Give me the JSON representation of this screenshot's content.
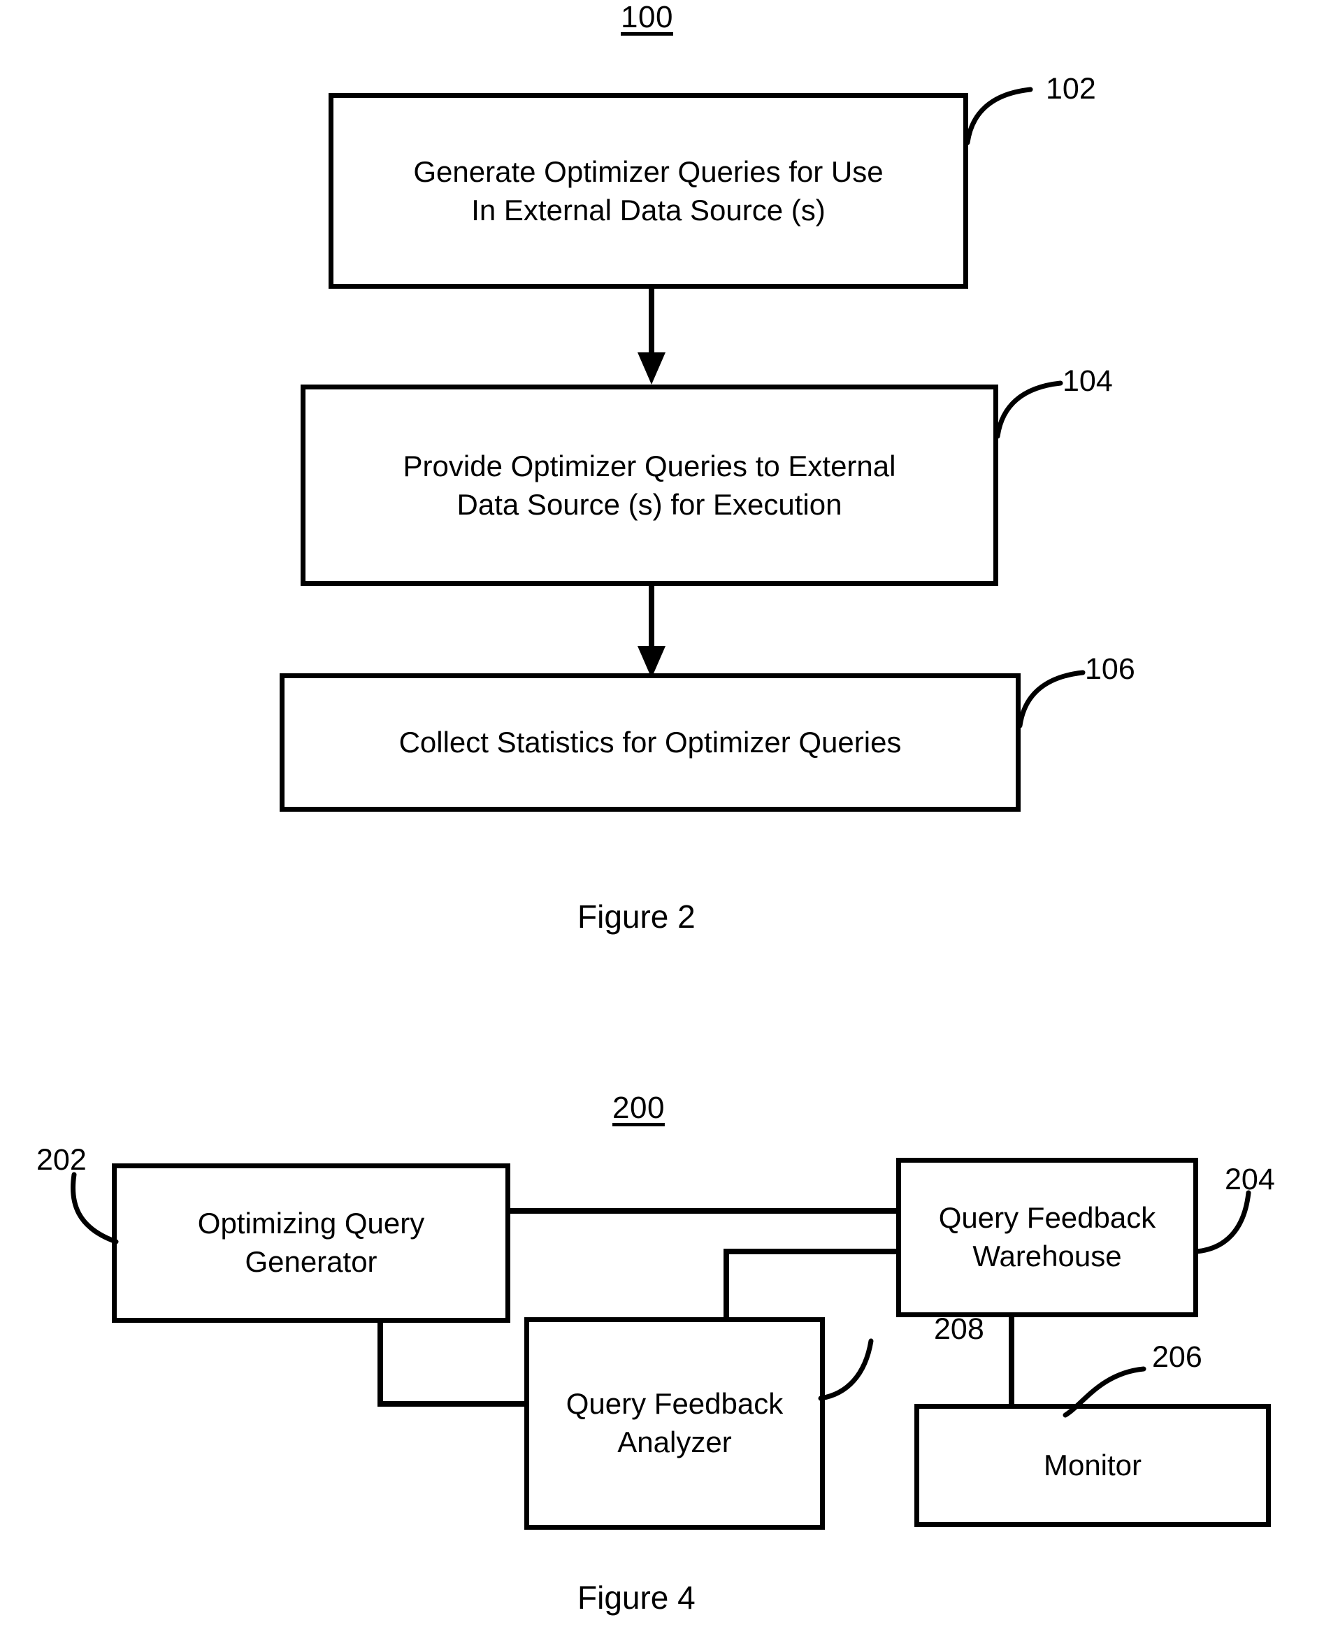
{
  "document": {
    "type": "patent-drawing-sheet",
    "ink_color": "#000000",
    "background_color": "#ffffff"
  },
  "figure2": {
    "diagram_number": "100",
    "caption": "Figure 2",
    "steps": [
      {
        "ref": "102",
        "text": "Generate Optimizer Queries for Use\nIn External Data Source  (s)"
      },
      {
        "ref": "104",
        "text": "Provide Optimizer Queries to External\nData Source (s) for Execution"
      },
      {
        "ref": "106",
        "text": "Collect Statistics for Optimizer Queries"
      }
    ],
    "flow": [
      {
        "from": "102",
        "to": "104",
        "marker": "arrow"
      },
      {
        "from": "104",
        "to": "106",
        "marker": "arrow"
      }
    ]
  },
  "figure4": {
    "diagram_number": "200",
    "caption": "Figure 4",
    "components": [
      {
        "ref": "202",
        "text": "Optimizing Query\nGenerator"
      },
      {
        "ref": "204",
        "text": "Query Feedback\nWarehouse"
      },
      {
        "ref": "206",
        "text": "Monitor"
      },
      {
        "ref": "208",
        "text": "Query Feedback\nAnalyzer"
      }
    ],
    "connections": [
      {
        "from": "202",
        "to": "204",
        "style": "straight"
      },
      {
        "from": "202",
        "to": "208",
        "style": "elbow"
      },
      {
        "from": "204",
        "to": "208",
        "style": "elbow"
      },
      {
        "from": "204",
        "to": "206",
        "style": "straight"
      }
    ]
  }
}
